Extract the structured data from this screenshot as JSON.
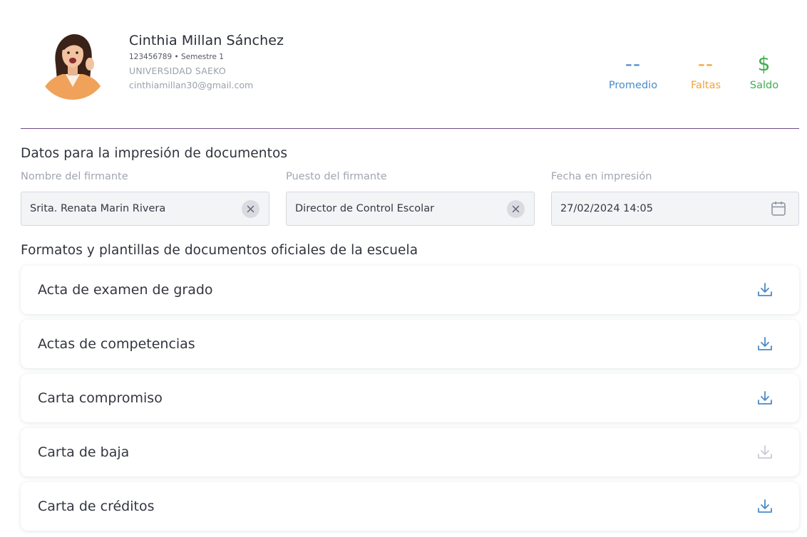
{
  "profile": {
    "name": "Cinthia Millan Sánchez",
    "meta": "123456789 • Semestre 1",
    "university": "UNIVERSIDAD SAEKO",
    "email": "cinthiamillan30@gmail.com"
  },
  "stats": [
    {
      "value": "--",
      "label": "Promedio",
      "color": "#4a8bc8"
    },
    {
      "value": "--",
      "label": "Faltas",
      "color": "#f0a33a"
    },
    {
      "value": "$",
      "label": "Saldo",
      "color": "#3fae4e"
    }
  ],
  "print_section": {
    "title": "Datos para la impresión de documentos",
    "fields": [
      {
        "label": "Nombre del firmante",
        "value": "Srita. Renata Marin Rivera",
        "icon": "clear-icon"
      },
      {
        "label": "Puesto del firmante",
        "value": "Director de Control Escolar",
        "icon": "clear-icon"
      },
      {
        "label": "Fecha en impresión",
        "value": "27/02/2024 14:05",
        "icon": "calendar-icon"
      }
    ]
  },
  "docs_section": {
    "title": "Formatos y plantillas de documentos oficiales de la escuela",
    "items": [
      {
        "label": "Acta de examen de grado",
        "icon": "download-icon",
        "enabled": true
      },
      {
        "label": "Actas de competencias",
        "icon": "download-icon",
        "enabled": true
      },
      {
        "label": "Carta compromiso",
        "icon": "download-icon",
        "enabled": true
      },
      {
        "label": "Carta de baja",
        "icon": "download-icon",
        "enabled": false
      },
      {
        "label": "Carta de créditos",
        "icon": "download-icon",
        "enabled": true
      }
    ]
  },
  "colors": {
    "divider": "#6d4b86",
    "download_enabled": "#4a8bc8",
    "download_disabled": "#c9ccd2"
  }
}
